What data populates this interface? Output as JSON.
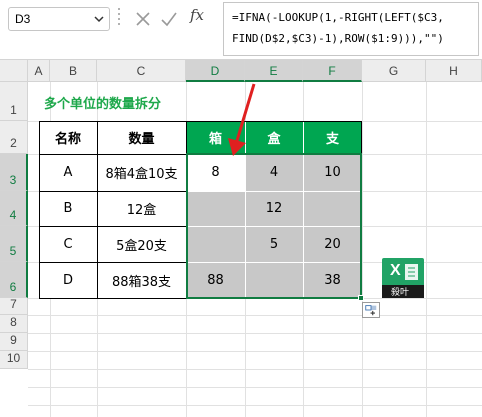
{
  "formula_bar": {
    "name_box": "D3",
    "cancel_icon": "x-icon",
    "enter_icon": "check-icon",
    "fx_label": "fx",
    "formula_line1": "=IFNA(-LOOKUP(1,-RIGHT(LEFT($C3,",
    "formula_line2": "FIND(D$2,$C3)-1),ROW($1:9))),\"\")"
  },
  "columns": [
    "A",
    "B",
    "C",
    "D",
    "E",
    "F",
    "G",
    "H"
  ],
  "rows": [
    "1",
    "2",
    "3",
    "4",
    "5",
    "6",
    "7",
    "8",
    "9",
    "10"
  ],
  "sheet_title": "多个单位的数量拆分",
  "table": {
    "headers": [
      "名称",
      "数量",
      "箱",
      "盒",
      "支"
    ],
    "rows": [
      {
        "name": "A",
        "qty": "8箱4盒10支",
        "xiang": "8",
        "he": "4",
        "zhi": "10"
      },
      {
        "name": "B",
        "qty": "12盒",
        "xiang": "",
        "he": "12",
        "zhi": ""
      },
      {
        "name": "C",
        "qty": "5盒20支",
        "xiang": "",
        "he": "5",
        "zhi": "20"
      },
      {
        "name": "D",
        "qty": "88箱38支",
        "xiang": "88",
        "he": "",
        "zhi": "38"
      }
    ]
  },
  "logo": {
    "letter": "X",
    "text": "殺叶"
  },
  "colors": {
    "green": "#00a651",
    "title_green": "#1ea84b",
    "selection": "#107c41",
    "grey": "#c8c8c8",
    "arrow": "#e02020"
  }
}
